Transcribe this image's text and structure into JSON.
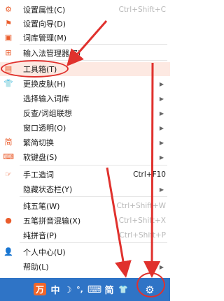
{
  "menu": {
    "items": [
      {
        "icon": "⚙",
        "icon_name": "gear-icon",
        "label": "设置属性(C)",
        "shortcut": "Ctrl+Shift+C",
        "shortcut_dim": true,
        "arrow": false
      },
      {
        "icon": "⚑",
        "icon_name": "flag-icon",
        "label": "设置向导(D)",
        "shortcut": "",
        "arrow": false
      },
      {
        "icon": "▣",
        "icon_name": "dictionary-icon",
        "label": "词库管理(M)",
        "shortcut": "",
        "arrow": false
      },
      {
        "icon": "⊞",
        "icon_name": "input-manager-icon",
        "label": "输入法管理器(Z)",
        "shortcut": "",
        "arrow": false
      },
      {
        "icon": "▤",
        "icon_name": "toolbox-icon",
        "label": "工具箱(T)",
        "shortcut": "",
        "arrow": false
      },
      {
        "icon": "👕",
        "icon_name": "shirt-icon",
        "label": "更换皮肤(H)",
        "shortcut": "",
        "arrow": true
      },
      {
        "icon": "",
        "icon_name": "",
        "label": "选择输入词库",
        "shortcut": "",
        "arrow": true
      },
      {
        "icon": "",
        "icon_name": "",
        "label": "反查/词组联想",
        "shortcut": "",
        "arrow": true
      },
      {
        "icon": "",
        "icon_name": "",
        "label": "窗口透明(O)",
        "shortcut": "",
        "arrow": true
      },
      {
        "icon": "简",
        "icon_name": "simplified-icon",
        "label": "繁简切换",
        "shortcut": "",
        "arrow": true
      },
      {
        "icon": "⌨",
        "icon_name": "keyboard-icon",
        "label": "软键盘(S)",
        "shortcut": "",
        "arrow": true
      },
      {
        "icon": "☞",
        "icon_name": "hand-icon",
        "label": "手工造词",
        "shortcut": "Ctrl+F10",
        "shortcut_dim": false,
        "arrow": false
      },
      {
        "icon": "",
        "icon_name": "",
        "label": "隐藏状态栏(Y)",
        "shortcut": "",
        "arrow": true
      },
      {
        "icon": "",
        "icon_name": "",
        "label": "纯五笔(W)",
        "shortcut": "Ctrl+Shift+W",
        "shortcut_dim": true,
        "arrow": false
      },
      {
        "icon": "●",
        "icon_name": "radio-dot-icon",
        "label": "五笔拼音混输(X)",
        "shortcut": "Ctrl+Shift+X",
        "shortcut_dim": true,
        "arrow": false
      },
      {
        "icon": "",
        "icon_name": "",
        "label": "纯拼音(P)",
        "shortcut": "Ctrl+Shift+P",
        "shortcut_dim": true,
        "arrow": false
      },
      {
        "icon": "👤",
        "icon_name": "person-icon",
        "label": "个人中心(U)",
        "shortcut": "",
        "arrow": false
      },
      {
        "icon": "",
        "icon_name": "",
        "label": "帮助(L)",
        "shortcut": "",
        "arrow": true
      }
    ]
  },
  "toolbar": {
    "logo": "万",
    "mode": "中",
    "moon": "☽",
    "punct": "°,",
    "keyboard": "⌨",
    "simplified": "简",
    "shirt": "👕",
    "gear": "⚙"
  },
  "colors": {
    "accent": "#ea5c2b",
    "toolbar": "#2f74c6",
    "annotation": "#e0312d",
    "selected_bg": "#fde9e2"
  }
}
